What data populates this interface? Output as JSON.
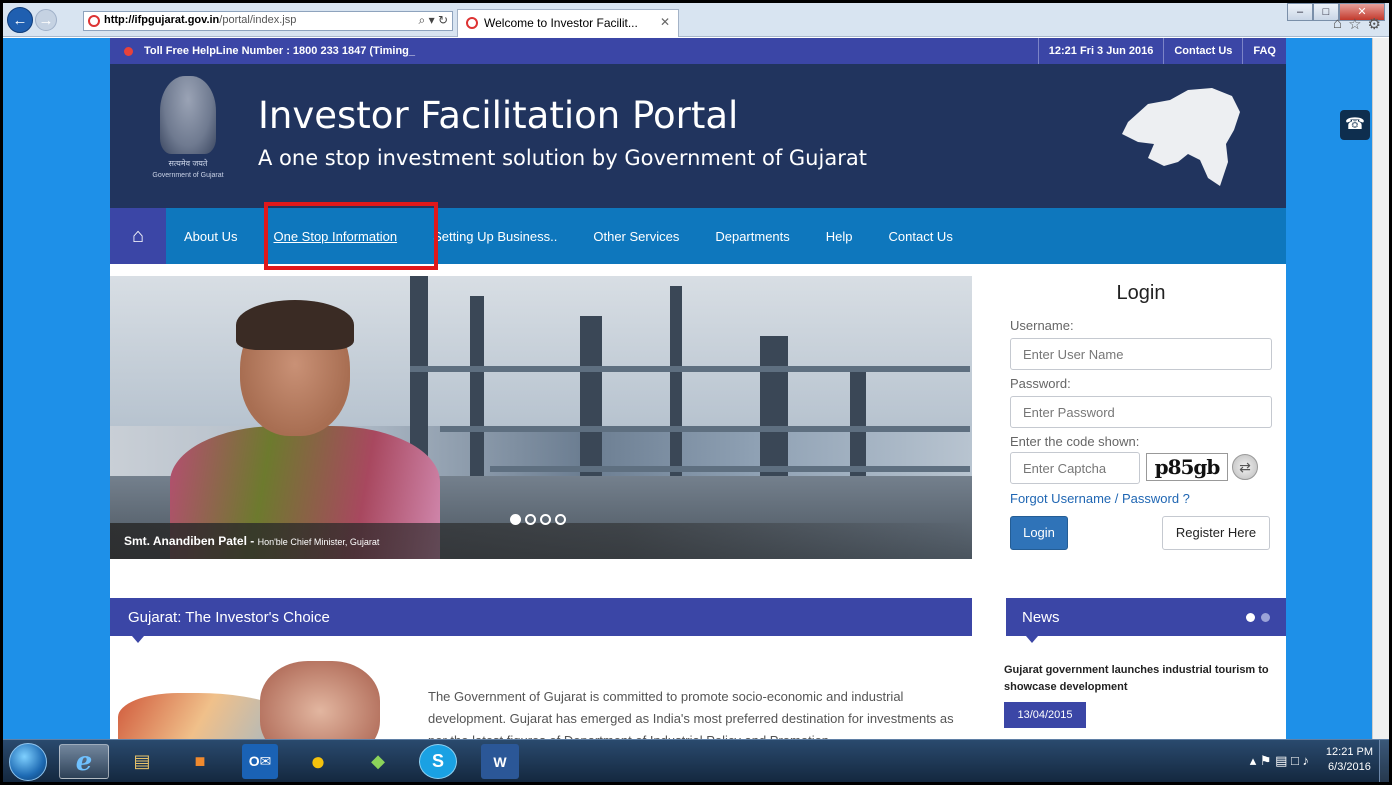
{
  "browser": {
    "url_host": "http://ifpgujarat.gov.in",
    "url_path": "/portal/index.jsp",
    "address_tools": "⌕ ▾ ↻",
    "tab_title": "Welcome to Investor Facilit...",
    "tab_close": "✕",
    "win_min": "–",
    "win_max": "□",
    "win_close": "✕",
    "home_icon": "⌂",
    "favorites_icon": "☆",
    "settings_icon": "⚙",
    "back_glyph": "←",
    "forward_glyph": "→"
  },
  "topbar": {
    "helpline": "Toll Free HelpLine Number : 1800 233 1847 (Timing_",
    "datetime": "12:21  Fri  3 Jun 2016",
    "contact": "Contact Us",
    "faq": "FAQ"
  },
  "header": {
    "title": "Investor Facilitation Portal",
    "subtitle": "A one stop investment solution by Government of Gujarat",
    "emblem_motto": "सत्यमेव जयते",
    "emblem_caption": "Government of Gujarat"
  },
  "nav": {
    "home_glyph": "⌂",
    "items": [
      "About Us",
      "One Stop Information",
      "Setting Up Business..",
      "Other Services",
      "Departments",
      "Help",
      "Contact Us"
    ]
  },
  "slider": {
    "caption_name": "Smt. Anandiben Patel - ",
    "caption_role": "Hon'ble Chief Minister, Gujarat",
    "slide_count": 4,
    "active_slide": 1
  },
  "login": {
    "title": "Login",
    "username_label": "Username:",
    "username_placeholder": "Enter User Name",
    "password_label": "Password:",
    "password_placeholder": "Enter Password",
    "captcha_label": "Enter the code shown:",
    "captcha_placeholder": "Enter Captcha",
    "captcha_code": "p85gb",
    "refresh_glyph": "⇄",
    "forgot": "Forgot Username / Password ?",
    "login_button": "Login",
    "register_button": "Register Here"
  },
  "investor": {
    "heading": "Gujarat: The Investor's Choice",
    "text": "The Government of Gujarat is committed to promote socio-economic and industrial development. Gujarat has emerged as India's most preferred destination for investments as per the latest figures of Department of Industrial Policy and Promotion"
  },
  "news": {
    "heading": "News",
    "headline": "Gujarat government launches industrial tourism to showcase development",
    "date": "13/04/2015"
  },
  "side": {
    "phone_glyph": "☎"
  },
  "taskbar": {
    "apps": [
      "e",
      "▤",
      "■",
      "O✉",
      "●",
      "◆",
      "S",
      "W"
    ],
    "tray_icons": "▴  ⚑  ▤  □  ♪",
    "time": "12:21 PM",
    "date": "6/3/2016"
  },
  "colors": {
    "topbar": "#3b46a6",
    "banner": "#21345e",
    "nav": "#0e77bd",
    "page_bg": "#1e90e8",
    "highlight": "#e0181b"
  }
}
